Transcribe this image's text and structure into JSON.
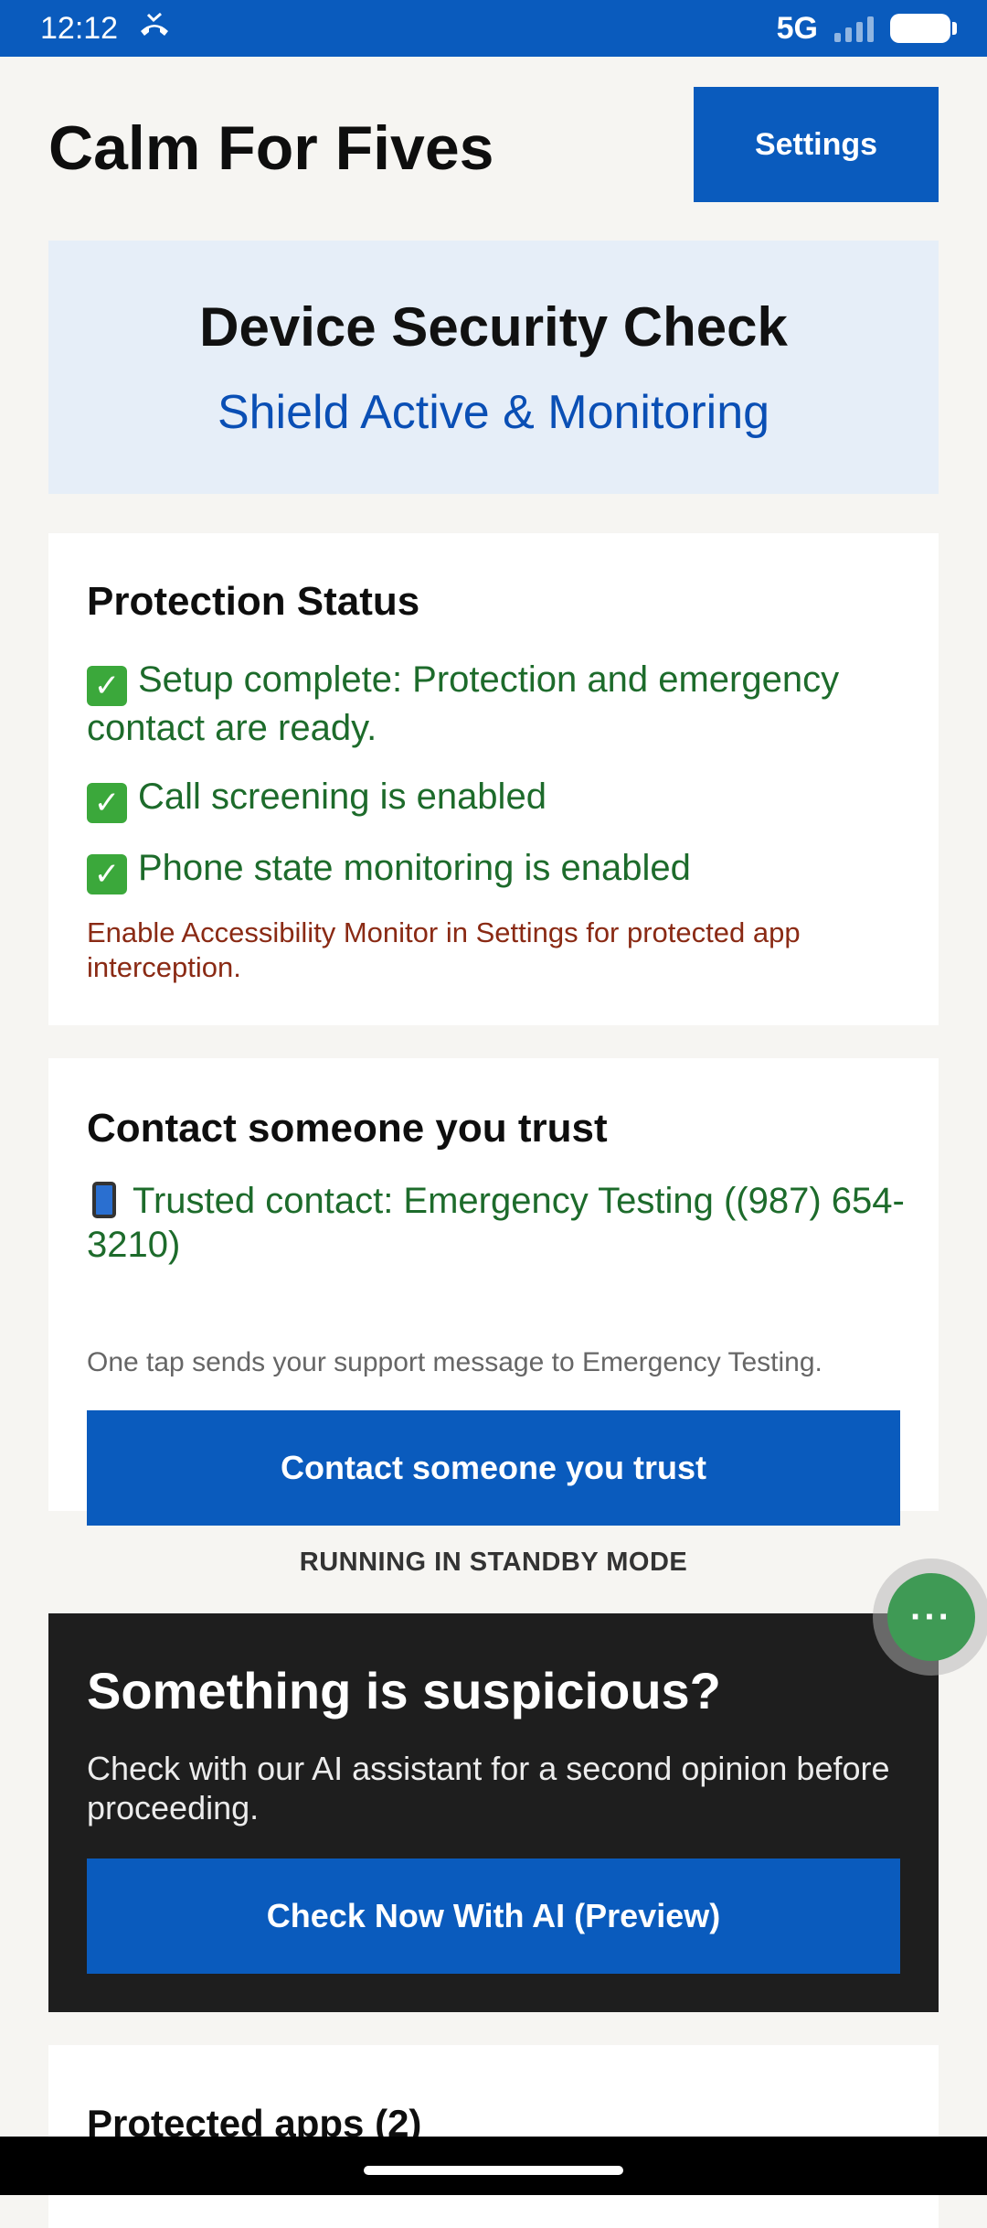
{
  "status_bar": {
    "time": "12:12",
    "network": "5G"
  },
  "header": {
    "app_title": "Calm For Fives",
    "settings_label": "Settings"
  },
  "hero": {
    "title": "Device Security Check",
    "subtitle": "Shield Active & Monitoring"
  },
  "protection": {
    "heading": "Protection Status",
    "items": [
      "Setup complete: Protection and emergency contact are ready.",
      "Call screening is enabled",
      "Phone state monitoring is enabled"
    ],
    "warning": "Enable Accessibility Monitor in Settings for protected app interception."
  },
  "trust": {
    "heading": "Contact someone you trust",
    "contact_line": "Trusted contact: Emergency Testing ((987) 654-3210)",
    "hint": "One tap sends your support message to Emergency Testing.",
    "button_label": "Contact someone you trust"
  },
  "standby_text": "RUNNING IN STANDBY MODE",
  "fab": {
    "label": "···"
  },
  "suspicious": {
    "title": "Something is suspicious?",
    "subtitle": "Check with our AI assistant for a second opinion before proceeding.",
    "button_label": "Check Now With AI (Preview)"
  },
  "apps": {
    "heading": "Protected apps (2)"
  },
  "colors": {
    "brand_blue": "#0a5bbd",
    "success_green": "#1d6b2b",
    "warning_red": "#8a2a14",
    "dark_card": "#1e1e1e"
  }
}
